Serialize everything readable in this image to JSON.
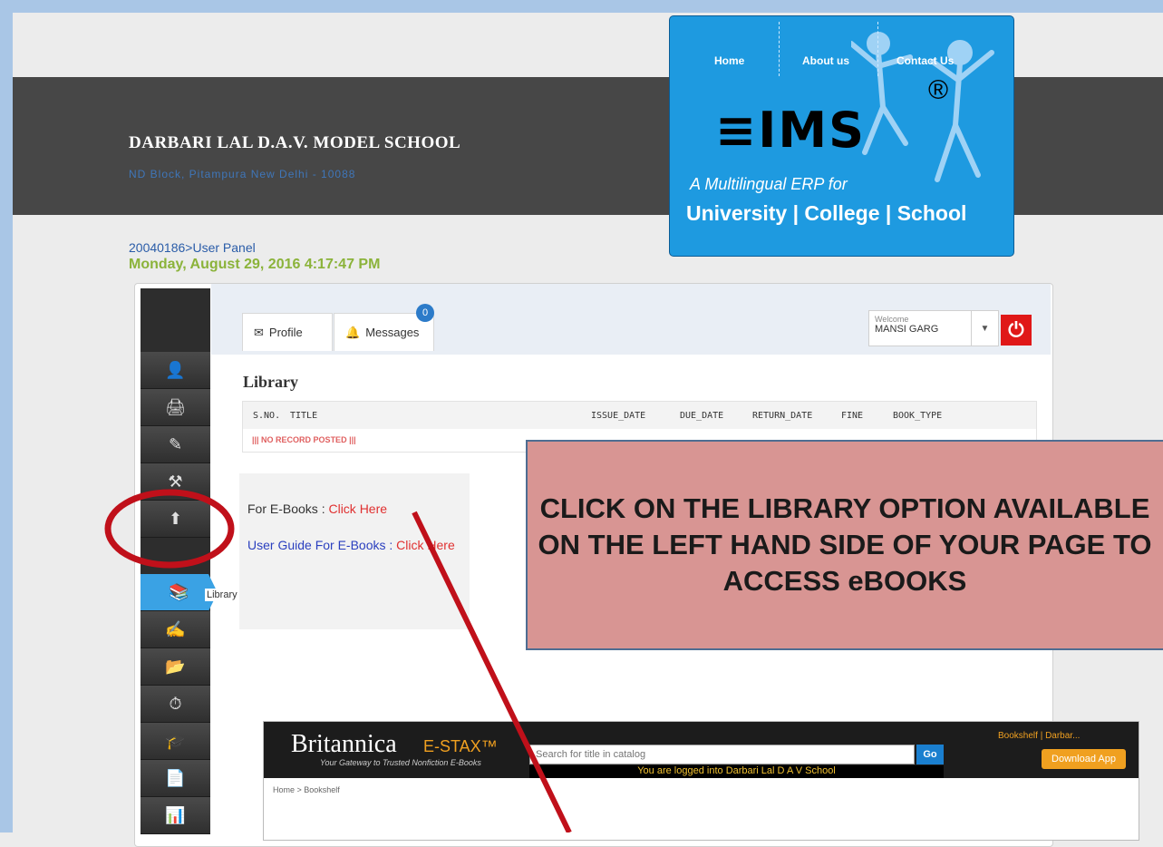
{
  "school": {
    "name": "DARBARI LAL D.A.V. MODEL SCHOOL",
    "address": "ND Block, Pitampura New Delhi - 10088"
  },
  "logo": {
    "nav": [
      "Home",
      "About us",
      "Contact Us"
    ],
    "brand": "≡IMS",
    "reg": "®",
    "tagline1": "A Multilingual ERP for",
    "tagline2": "University | College | School"
  },
  "user_panel": "20040186>User Panel",
  "datetime": "Monday, August 29, 2016 4:17:47 PM",
  "tabs": {
    "profile": "Profile",
    "messages": "Messages",
    "messages_count": "0"
  },
  "welcome": {
    "label": "Welcome",
    "name": "MANSI GARG"
  },
  "sidebar": {
    "tooltip": "Library"
  },
  "library": {
    "title": "Library",
    "columns": [
      "S.NO.",
      "TITLE",
      "ISSUE_DATE",
      "DUE_DATE",
      "RETURN_DATE",
      "FINE",
      "BOOK_TYPE"
    ],
    "empty_message": "||| NO RECORD POSTED |||"
  },
  "ebooks": {
    "label1": "For E-Books : ",
    "link1": "Click Here",
    "label2": "User Guide For E-Books : ",
    "link2": "Click Here"
  },
  "callout": "CLICK ON THE LIBRARY OPTION AVAILABLE ON THE LEFT HAND SIDE OF YOUR PAGE TO ACCESS eBOOKS",
  "britannica": {
    "logo": "Britannica",
    "product": "E-STAX™",
    "subtitle": "Your Gateway to Trusted Nonfiction E-Books",
    "search_placeholder": "Search for title in catalog",
    "go": "Go",
    "logged_in": "You are logged into Darbari Lal D A V School",
    "bookshelf": "Bookshelf  |  Darbar...",
    "download": "Download App",
    "breadcrumb": "Home > Bookshelf"
  }
}
